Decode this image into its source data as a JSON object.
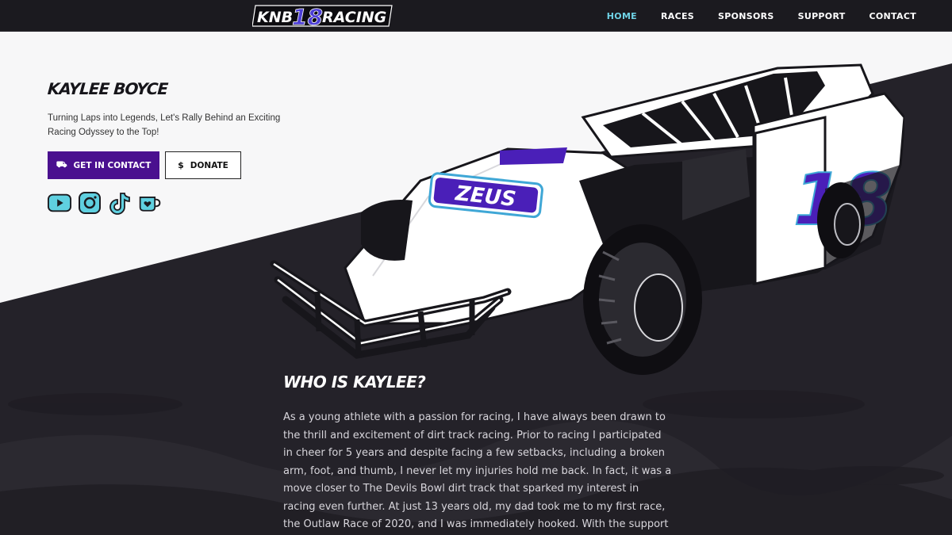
{
  "brand": {
    "logo_left": "KNB",
    "logo_number": "18",
    "logo_right": "RACING"
  },
  "nav": {
    "items": [
      {
        "label": "HOME",
        "active": true
      },
      {
        "label": "RACES",
        "active": false
      },
      {
        "label": "SPONSORS",
        "active": false
      },
      {
        "label": "SUPPORT",
        "active": false
      },
      {
        "label": "CONTACT",
        "active": false
      }
    ]
  },
  "hero": {
    "title": "KAYLEE BOYCE",
    "subtitle": "Turning Laps into Legends, Let's Rally Behind an Exciting Racing Odyssey to the Top!",
    "contact_button": "GET IN CONTACT",
    "donate_button": "DONATE",
    "socials": [
      "youtube-icon",
      "instagram-icon",
      "tiktok-icon",
      "kofi-icon"
    ]
  },
  "car": {
    "sponsor": "ZEUS",
    "number": "18"
  },
  "about": {
    "title": "WHO IS KAYLEE?",
    "text": "As a young athlete with a passion for racing, I have always been drawn to the thrill and excitement of dirt track racing. Prior to racing I participated in cheer for 5 years and despite facing a few setbacks, including a broken arm, foot, and thumb, I never let my injuries hold me back. In fact, it was a move closer to The Devils Bowl dirt track that sparked my interest in racing even further. At just 13 years old, my dad took me to my first race, the Outlaw Race of 2020, and I was immediately hooked. With the support of my"
  },
  "colors": {
    "accent": "#4a108f",
    "nav_active": "#6fd3e6",
    "social": "#5fd0e0",
    "dark_bg": "#242229",
    "light_bg": "#f7f7f8"
  }
}
